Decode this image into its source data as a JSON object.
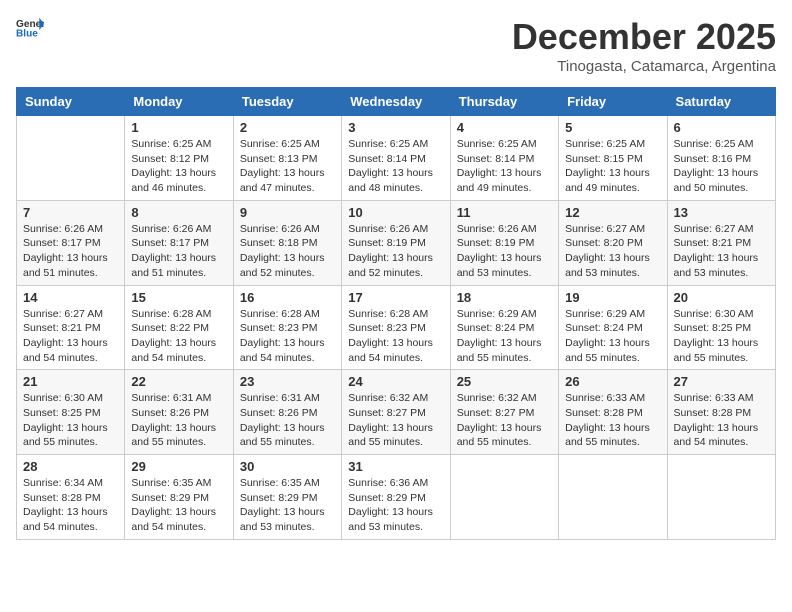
{
  "logo": {
    "general": "General",
    "blue": "Blue"
  },
  "header": {
    "month": "December 2025",
    "location": "Tinogasta, Catamarca, Argentina"
  },
  "weekdays": [
    "Sunday",
    "Monday",
    "Tuesday",
    "Wednesday",
    "Thursday",
    "Friday",
    "Saturday"
  ],
  "weeks": [
    [
      {
        "day": "",
        "info": ""
      },
      {
        "day": "1",
        "info": "Sunrise: 6:25 AM\nSunset: 8:12 PM\nDaylight: 13 hours\nand 46 minutes."
      },
      {
        "day": "2",
        "info": "Sunrise: 6:25 AM\nSunset: 8:13 PM\nDaylight: 13 hours\nand 47 minutes."
      },
      {
        "day": "3",
        "info": "Sunrise: 6:25 AM\nSunset: 8:14 PM\nDaylight: 13 hours\nand 48 minutes."
      },
      {
        "day": "4",
        "info": "Sunrise: 6:25 AM\nSunset: 8:14 PM\nDaylight: 13 hours\nand 49 minutes."
      },
      {
        "day": "5",
        "info": "Sunrise: 6:25 AM\nSunset: 8:15 PM\nDaylight: 13 hours\nand 49 minutes."
      },
      {
        "day": "6",
        "info": "Sunrise: 6:25 AM\nSunset: 8:16 PM\nDaylight: 13 hours\nand 50 minutes."
      }
    ],
    [
      {
        "day": "7",
        "info": "Sunrise: 6:26 AM\nSunset: 8:17 PM\nDaylight: 13 hours\nand 51 minutes."
      },
      {
        "day": "8",
        "info": "Sunrise: 6:26 AM\nSunset: 8:17 PM\nDaylight: 13 hours\nand 51 minutes."
      },
      {
        "day": "9",
        "info": "Sunrise: 6:26 AM\nSunset: 8:18 PM\nDaylight: 13 hours\nand 52 minutes."
      },
      {
        "day": "10",
        "info": "Sunrise: 6:26 AM\nSunset: 8:19 PM\nDaylight: 13 hours\nand 52 minutes."
      },
      {
        "day": "11",
        "info": "Sunrise: 6:26 AM\nSunset: 8:19 PM\nDaylight: 13 hours\nand 53 minutes."
      },
      {
        "day": "12",
        "info": "Sunrise: 6:27 AM\nSunset: 8:20 PM\nDaylight: 13 hours\nand 53 minutes."
      },
      {
        "day": "13",
        "info": "Sunrise: 6:27 AM\nSunset: 8:21 PM\nDaylight: 13 hours\nand 53 minutes."
      }
    ],
    [
      {
        "day": "14",
        "info": "Sunrise: 6:27 AM\nSunset: 8:21 PM\nDaylight: 13 hours\nand 54 minutes."
      },
      {
        "day": "15",
        "info": "Sunrise: 6:28 AM\nSunset: 8:22 PM\nDaylight: 13 hours\nand 54 minutes."
      },
      {
        "day": "16",
        "info": "Sunrise: 6:28 AM\nSunset: 8:23 PM\nDaylight: 13 hours\nand 54 minutes."
      },
      {
        "day": "17",
        "info": "Sunrise: 6:28 AM\nSunset: 8:23 PM\nDaylight: 13 hours\nand 54 minutes."
      },
      {
        "day": "18",
        "info": "Sunrise: 6:29 AM\nSunset: 8:24 PM\nDaylight: 13 hours\nand 55 minutes."
      },
      {
        "day": "19",
        "info": "Sunrise: 6:29 AM\nSunset: 8:24 PM\nDaylight: 13 hours\nand 55 minutes."
      },
      {
        "day": "20",
        "info": "Sunrise: 6:30 AM\nSunset: 8:25 PM\nDaylight: 13 hours\nand 55 minutes."
      }
    ],
    [
      {
        "day": "21",
        "info": "Sunrise: 6:30 AM\nSunset: 8:25 PM\nDaylight: 13 hours\nand 55 minutes."
      },
      {
        "day": "22",
        "info": "Sunrise: 6:31 AM\nSunset: 8:26 PM\nDaylight: 13 hours\nand 55 minutes."
      },
      {
        "day": "23",
        "info": "Sunrise: 6:31 AM\nSunset: 8:26 PM\nDaylight: 13 hours\nand 55 minutes."
      },
      {
        "day": "24",
        "info": "Sunrise: 6:32 AM\nSunset: 8:27 PM\nDaylight: 13 hours\nand 55 minutes."
      },
      {
        "day": "25",
        "info": "Sunrise: 6:32 AM\nSunset: 8:27 PM\nDaylight: 13 hours\nand 55 minutes."
      },
      {
        "day": "26",
        "info": "Sunrise: 6:33 AM\nSunset: 8:28 PM\nDaylight: 13 hours\nand 55 minutes."
      },
      {
        "day": "27",
        "info": "Sunrise: 6:33 AM\nSunset: 8:28 PM\nDaylight: 13 hours\nand 54 minutes."
      }
    ],
    [
      {
        "day": "28",
        "info": "Sunrise: 6:34 AM\nSunset: 8:28 PM\nDaylight: 13 hours\nand 54 minutes."
      },
      {
        "day": "29",
        "info": "Sunrise: 6:35 AM\nSunset: 8:29 PM\nDaylight: 13 hours\nand 54 minutes."
      },
      {
        "day": "30",
        "info": "Sunrise: 6:35 AM\nSunset: 8:29 PM\nDaylight: 13 hours\nand 53 minutes."
      },
      {
        "day": "31",
        "info": "Sunrise: 6:36 AM\nSunset: 8:29 PM\nDaylight: 13 hours\nand 53 minutes."
      },
      {
        "day": "",
        "info": ""
      },
      {
        "day": "",
        "info": ""
      },
      {
        "day": "",
        "info": ""
      }
    ]
  ]
}
